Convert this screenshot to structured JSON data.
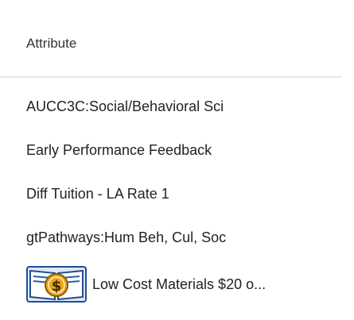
{
  "table": {
    "column_header": "Attribute",
    "rows": [
      {
        "label": "AUCC3C:Social/Behavioral Sci"
      },
      {
        "label": "Early Performance Feedback"
      },
      {
        "label": "Diff Tuition - LA Rate 1"
      },
      {
        "label": "gtPathways:Hum Beh, Cul, Soc"
      },
      {
        "label": "Low Cost Materials $20 o...",
        "icon": "low-cost-materials-book-icon"
      }
    ]
  },
  "colors": {
    "icon_blue": "#2b5fa8",
    "icon_gold": "#e8a51c",
    "divider": "#e7e7e7"
  }
}
